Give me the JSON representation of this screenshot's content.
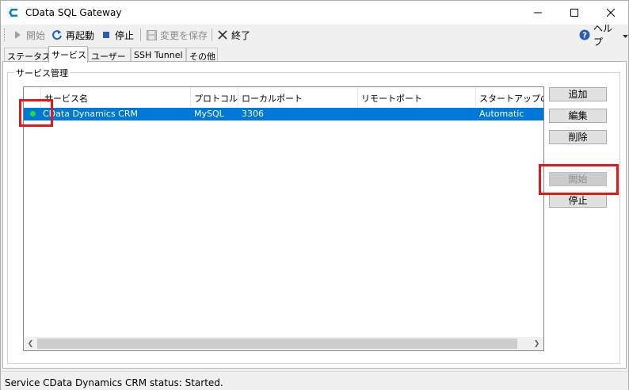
{
  "window": {
    "title": "CData SQL Gateway",
    "icon": "cdata-logo-icon"
  },
  "toolbar": {
    "start_label": "開始",
    "restart_label": "再起動",
    "stop_label": "停止",
    "save_label": "変更を保存",
    "exit_label": "終了",
    "help_label": "ヘルプ"
  },
  "tabs": [
    {
      "label": "ステータス",
      "active": false
    },
    {
      "label": "サービス",
      "active": true
    },
    {
      "label": "ユーザー",
      "active": false
    },
    {
      "label": "SSH Tunnel",
      "active": false
    },
    {
      "label": "その他",
      "active": false
    }
  ],
  "service_group": {
    "title": "サービス管理",
    "columns": [
      "サービス名",
      "プロトコル",
      "ローカルポート",
      "リモートポート",
      "スタートアップの種"
    ],
    "rows": [
      {
        "name": "CData Dynamics CRM",
        "protocol": "MySQL",
        "local_port": "3306",
        "remote_port": "",
        "startup": "Automatic",
        "status_color": "#22e02e",
        "selected": true
      }
    ]
  },
  "buttons": {
    "add_label": "追加",
    "edit_label": "編集",
    "delete_label": "削除",
    "start_label": "開始",
    "stop_label": "停止"
  },
  "statusbar": {
    "text": "Service CData Dynamics CRM  status: Started."
  },
  "colors": {
    "selection": "#0078d7",
    "highlight": "#e8151b",
    "running": "#22e02e"
  }
}
